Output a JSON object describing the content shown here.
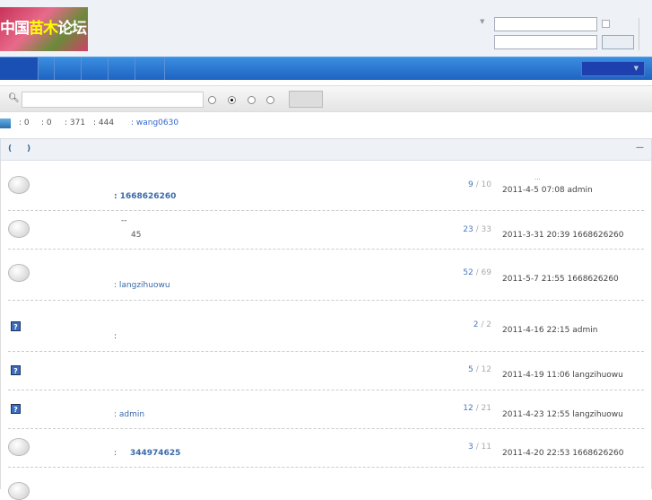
{
  "header": {
    "logo_text_a": "中国",
    "logo_text_b": "苗木",
    "logo_text_c": "论坛"
  },
  "stats": {
    "s1": ": 0",
    "s2": ": 0",
    "s3": ": 371",
    "s4": ": 444",
    "newest_member": ": wang0630"
  },
  "table": {
    "paren_open": "(",
    "paren_close": ")",
    "collapse": "—"
  },
  "rows": [
    {
      "icon": "bubble",
      "replies": "9",
      "views": "10",
      "last_top": "...",
      "last": "2011-4-5 07:08 admin",
      "sub": ": 1668626260",
      "sub_bold": true
    },
    {
      "icon": "bubble",
      "title": "--",
      "extra": "45",
      "replies": "23",
      "views": "33",
      "last": "2011-3-31 20:39 1668626260"
    },
    {
      "icon": "bubble",
      "replies": "52",
      "views": "69",
      "last": "2011-5-7 21:55 1668626260",
      "sub": ": langzihuowu"
    },
    {
      "icon": "question",
      "replies": "2",
      "views": "2",
      "last": "2011-4-16 22:15 admin",
      "sub": ":"
    },
    {
      "icon": "question",
      "replies": "5",
      "views": "12",
      "last": "2011-4-19 11:06 langzihuowu"
    },
    {
      "icon": "question",
      "replies": "12",
      "views": "21",
      "last": "2011-4-23 12:55 langzihuowu",
      "sub": ": admin"
    },
    {
      "icon": "bubble",
      "replies": "3",
      "views": "11",
      "last": "2011-4-20 22:53 1668626260",
      "sub_colon": ":",
      "sub": "344974625",
      "sub_bold": true
    }
  ]
}
